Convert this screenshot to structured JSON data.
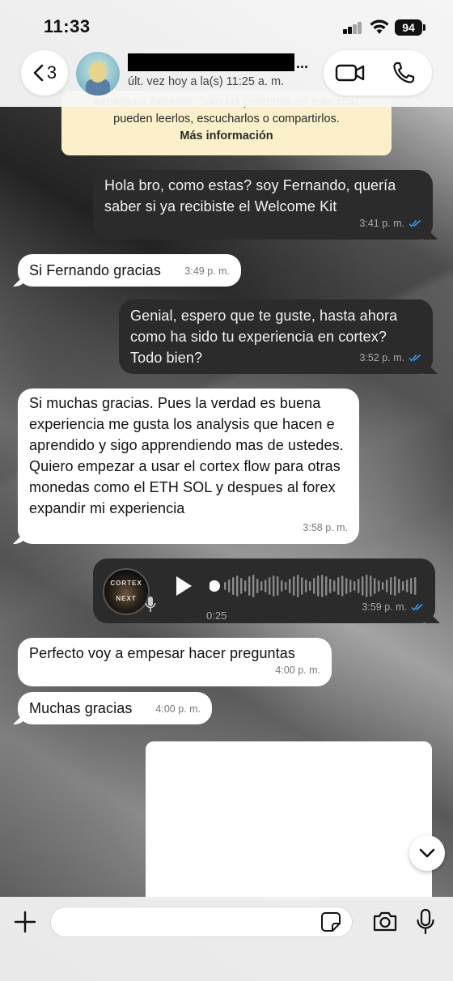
{
  "status_bar": {
    "time": "11:33",
    "battery": "94"
  },
  "header": {
    "back_count": "3",
    "name_suffix": "...",
    "last_seen": "últ. vez hoy a la(s) 11:25 a. m."
  },
  "encryption_notice": {
    "line1": "extremo a extremo. Solo las personas en este chat",
    "line2": "pueden leerlos, escucharlos o compartirlos.",
    "link": "Más información"
  },
  "messages": [
    {
      "dir": "out",
      "text": "Hola bro, como estas? soy Fernando, quería saber si ya recibiste el Welcome Kit",
      "time": "3:41 p. m.",
      "status": "read"
    },
    {
      "dir": "in",
      "text": "Si Fernando gracias",
      "time": "3:49 p. m."
    },
    {
      "dir": "out",
      "text": "Genial, espero que te guste, hasta ahora como ha sido tu experiencia en cortex? Todo bien?",
      "time": "3:52 p. m.",
      "status": "read"
    },
    {
      "dir": "in",
      "text": "Si muchas gracias. Pues la verdad es buena experiencia me gusta los analysis que hacen e aprendido y sigo apprendiendo mas de ustedes. Quiero empezar a usar el cortex flow para otras monedas como el ETH SOL y despues al forex expandir mi experiencia",
      "time": "3:58 p. m."
    },
    {
      "dir": "out",
      "type": "voice",
      "duration": "0:25",
      "time": "3:59 p. m.",
      "status": "read",
      "avatar_text_top": "CORTEX",
      "avatar_text_bottom": "NEXT"
    },
    {
      "dir": "in",
      "text": "Perfecto voy a empesar hacer preguntas",
      "time": "4:00 p. m."
    },
    {
      "dir": "in",
      "text": "Muchas gracias",
      "time": "4:00 p. m."
    }
  ],
  "composer": {
    "value": "",
    "placeholder": ""
  },
  "colors": {
    "outgoing_bubble": "#2b2b2b",
    "incoming_bubble": "#ffffff",
    "read_ticks": "#3b9cf5",
    "encryption_banner": "#fbf0c9"
  }
}
